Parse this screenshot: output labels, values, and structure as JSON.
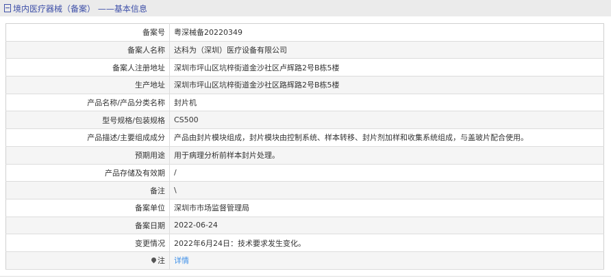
{
  "header": {
    "title": "境内医疗器械（备案） ——基本信息"
  },
  "rows": [
    {
      "label": "备案号",
      "value": "粤深械备20220349"
    },
    {
      "label": "备案人名称",
      "value": "达科为（深圳）医疗设备有限公司"
    },
    {
      "label": "备案人注册地址",
      "value": "深圳市坪山区坑梓街道金沙社区卢辉路2号B栋5楼"
    },
    {
      "label": "生产地址",
      "value": "深圳市坪山区坑梓街道金沙社区路辉路2号B栋5楼"
    },
    {
      "label": "产品名称/产品分类名称",
      "value": "封片机"
    },
    {
      "label": "型号规格/包装规格",
      "value": "CS500"
    },
    {
      "label": "产品描述/主要组成成分",
      "value": "产品由封片模块组成，封片模块由控制系统、样本转移、封片剂加样和收集系统组成，与盖玻片配合使用。"
    },
    {
      "label": "预期用途",
      "value": "用于病理分析前样本封片处理。"
    },
    {
      "label": "产品存储及有效期",
      "value": "/"
    },
    {
      "label": "备注",
      "value": "\\"
    },
    {
      "label": "备案单位",
      "value": "深圳市市场监督管理局"
    },
    {
      "label": "备案日期",
      "value": "2022-06-24"
    },
    {
      "label": "变更情况",
      "value": "2022年6月24日：技术要求发生变化。"
    }
  ],
  "note": {
    "label": "注",
    "link": "详情"
  }
}
